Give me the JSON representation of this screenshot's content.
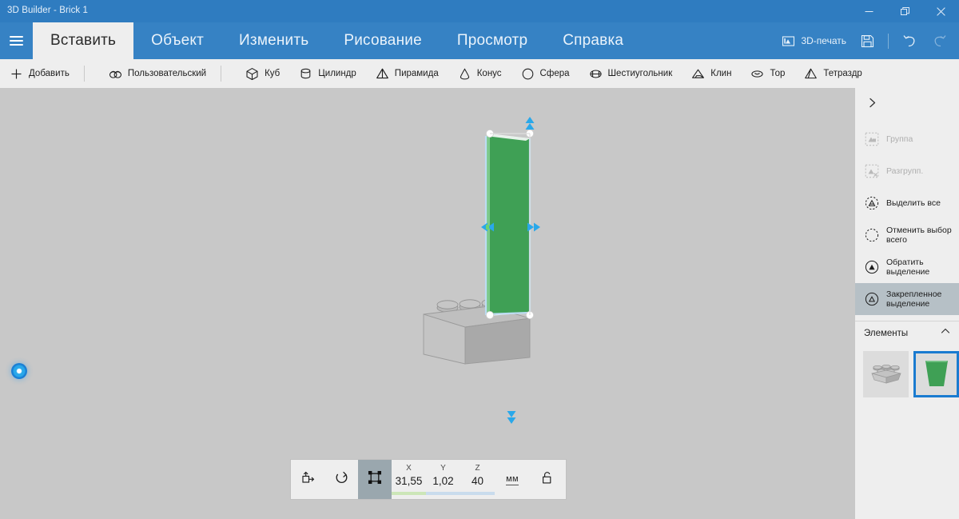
{
  "window": {
    "title": "3D Builder  - Brick 1",
    "controls": [
      {
        "name": "minimize",
        "glyph": "minimize-icon"
      },
      {
        "name": "restore",
        "glyph": "restore-icon"
      },
      {
        "name": "close",
        "glyph": "close-icon"
      }
    ]
  },
  "ribbon": {
    "menu_button": "menu-icon",
    "tabs": [
      {
        "label": "Вставить",
        "active": true
      },
      {
        "label": "Объект",
        "active": false
      },
      {
        "label": "Изменить",
        "active": false
      },
      {
        "label": "Рисование",
        "active": false
      },
      {
        "label": "Просмотр",
        "active": false
      },
      {
        "label": "Справка",
        "active": false
      }
    ],
    "actions": {
      "print3d_label": "3D-печать",
      "print3d_icon": "print-3d-icon",
      "save_icon": "save-icon",
      "undo_icon": "undo-icon",
      "redo_icon": "redo-icon"
    }
  },
  "commandbar": {
    "add_label": "Добавить",
    "custom_label": "Пользовательский",
    "shapes": [
      {
        "label": "Куб",
        "icon": "cube-icon"
      },
      {
        "label": "Цилиндр",
        "icon": "cylinder-icon"
      },
      {
        "label": "Пирамида",
        "icon": "pyramid-icon"
      },
      {
        "label": "Конус",
        "icon": "cone-icon"
      },
      {
        "label": "Сфера",
        "icon": "sphere-icon"
      },
      {
        "label": "Шестиугольник",
        "icon": "hexagon-icon"
      },
      {
        "label": "Клин",
        "icon": "wedge-icon"
      },
      {
        "label": "Тор",
        "icon": "torus-icon"
      },
      {
        "label": "Тетраздр",
        "icon": "tetrahedron-icon"
      }
    ]
  },
  "sidebar": {
    "expand_icon": "chevron-right-icon",
    "items": [
      {
        "label": "Группа",
        "icon": "group-icon",
        "state": "disabled"
      },
      {
        "label": "Разгрупп.",
        "icon": "ungroup-icon",
        "state": "disabled"
      },
      {
        "label": "Выделить все",
        "icon": "select-all-icon",
        "state": "enabled"
      },
      {
        "label": "Отменить выбор всего",
        "icon": "deselect-all-icon",
        "state": "enabled"
      },
      {
        "label": "Обратить выделение",
        "icon": "invert-selection-icon",
        "state": "enabled"
      },
      {
        "label": "Закрепленное выделение",
        "icon": "pinned-selection-icon",
        "state": "active"
      }
    ],
    "section": {
      "title": "Элементы",
      "collapse_icon": "chevron-up-icon",
      "thumbnails": [
        {
          "name": "brick-base-thumbnail",
          "selected": false
        },
        {
          "name": "green-wedge-thumbnail",
          "selected": true
        }
      ]
    }
  },
  "bottom_toolbar": {
    "buttons": [
      {
        "name": "move-tool",
        "icon": "move-icon",
        "active": false
      },
      {
        "name": "rotate-tool",
        "icon": "rotate-icon",
        "active": false
      },
      {
        "name": "scale-tool",
        "icon": "scale-icon",
        "active": true
      }
    ],
    "axes": [
      {
        "label": "X",
        "value": "31,55",
        "bar_color": "#cce6b8"
      },
      {
        "label": "Y",
        "value": "1,02",
        "bar_color": "#c9dced"
      },
      {
        "label": "Z",
        "value": "40",
        "bar_color": "#c9dced"
      }
    ],
    "unit": "мм",
    "lock_icon": "unlock-icon"
  },
  "viewport": {
    "assistant_orb": "cortana-orb-icon",
    "selected_object": "green-wedge",
    "base_object": "grey-lego-brick"
  },
  "colors": {
    "titlebar": "#2f7cc0",
    "ribbon": "#3682c4",
    "active_tab_bg": "#eeeeee",
    "viewport_bg": "#c8c8c8",
    "panel_bg": "#eeeeee",
    "selection_accent": "#1a7bd0",
    "object_green": "#3fa055",
    "gizmo_blue": "#29a8ea"
  }
}
